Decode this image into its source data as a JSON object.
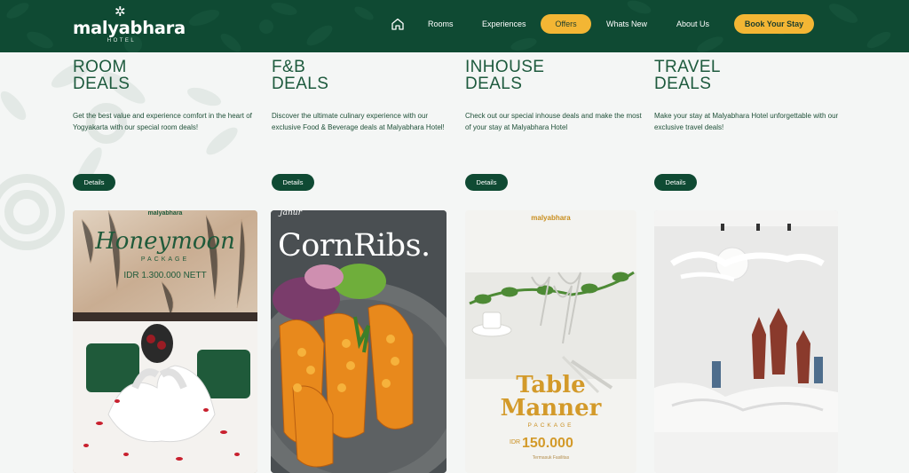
{
  "header": {
    "logo_name": "malyabhara",
    "logo_sub": "HOTEL",
    "nav": {
      "home_icon": "home-icon",
      "rooms": "Rooms",
      "experiences": "Experiences",
      "offers": "Offers",
      "whats_new": "Whats New",
      "about_us": "About Us",
      "book": "Book Your Stay"
    },
    "colors": {
      "primary": "#0f4a33",
      "accent": "#f3b634"
    }
  },
  "deals": [
    {
      "title_1": "ROOM",
      "title_2": "DEALS",
      "desc": "Get the best value and experience comfort in the heart of Yogyakarta with our special room deals!",
      "button": "Details"
    },
    {
      "title_1": "F&B",
      "title_2": "DEALS",
      "desc": "Discover the ultimate culinary experience with our exclusive Food & Beverage deals at Malyabhara Hotel!",
      "button": "Details"
    },
    {
      "title_1": "INHOUSE",
      "title_2": "DEALS",
      "desc": "Check out our special inhouse deals and make the most of your stay at Malyabhara Hotel",
      "button": "Details"
    },
    {
      "title_1": "TRAVEL",
      "title_2": "DEALS",
      "desc": "Make your stay at Malyabhara Hotel unforgettable with our exclusive travel deals!",
      "button": "Details"
    }
  ],
  "cards": {
    "honeymoon": {
      "brand": "malyabhara",
      "title": "Honeymoon",
      "subtitle": "PACKAGE",
      "price": "IDR 1.300.000 NETT"
    },
    "cornribs": {
      "brand": "Janur",
      "title": "CornRibs."
    },
    "table": {
      "brand": "malyabhara",
      "title_1": "Table",
      "title_2": "Manner",
      "subtitle": "PACKAGE",
      "price_prefix": "IDR",
      "price": "150.000",
      "note": "Termasuk Fasilitas"
    },
    "travel": {}
  }
}
